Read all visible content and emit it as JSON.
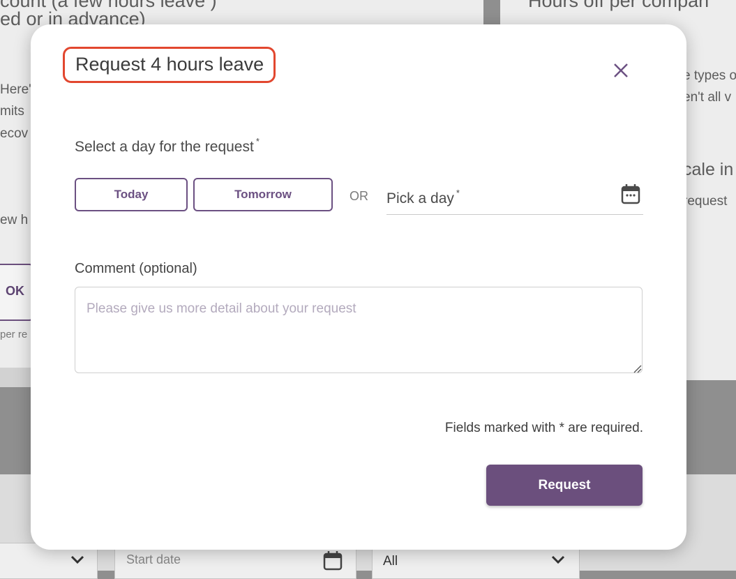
{
  "background": {
    "heading_left_line1": "count (a few hours leave )",
    "heading_left_line2": "ed or in advance)",
    "heading_right": "Hours off per compan",
    "left_lines": [
      "Here's",
      "mits",
      "ecov"
    ],
    "left_line_ew": "ew h",
    "ok_label": "OK",
    "left_small": "per re",
    "right_lines": [
      "e types o",
      "en't all v"
    ],
    "right_heading": "cale in",
    "right_request": "request",
    "start_date_placeholder": "Start date",
    "filter_value": "All"
  },
  "modal": {
    "title": "Request 4 hours leave",
    "day_label": "Select a day for the request",
    "required_mark": "*",
    "today_label": "Today",
    "tomorrow_label": "Tomorrow",
    "or_label": "OR",
    "pick_day_label": "Pick a day",
    "comment_label": "Comment (optional)",
    "comment_placeholder": "Please give us more detail about your request",
    "required_note": "Fields marked with * are required.",
    "submit_label": "Request"
  },
  "colors": {
    "accent": "#6b4f7d",
    "highlight_outline": "#e2472f"
  },
  "icons": [
    "close-icon",
    "calendar-icon",
    "chevron-down-icon",
    "resize-handle-icon"
  ]
}
